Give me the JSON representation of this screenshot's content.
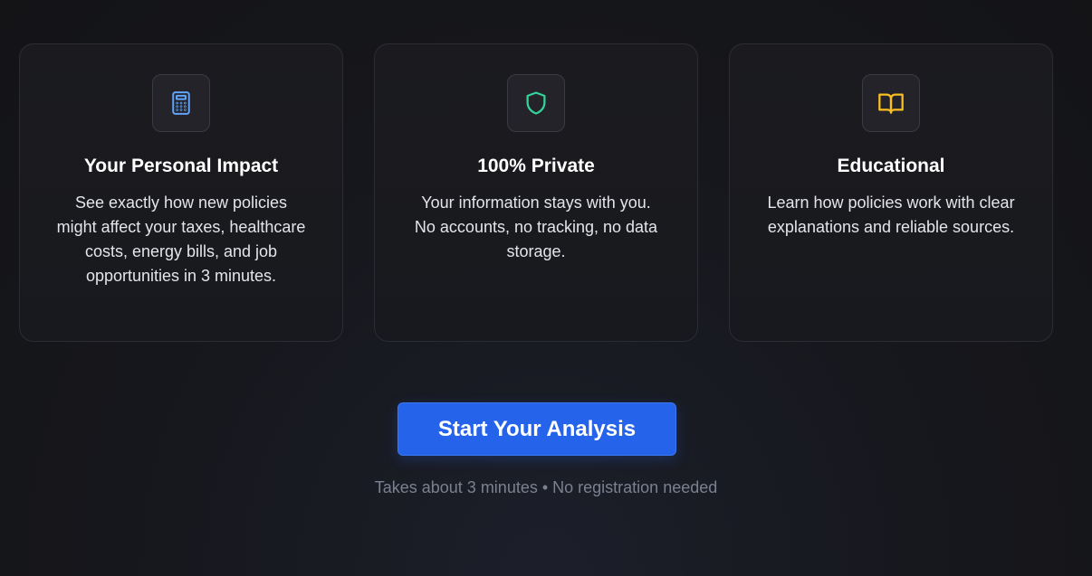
{
  "features": [
    {
      "icon": "calculator-icon",
      "icon_color": "#60a5fa",
      "title": "Your Personal Impact",
      "description": "See exactly how new policies might affect your taxes, healthcare costs, energy bills, and job opportunities in 3 minutes."
    },
    {
      "icon": "shield-icon",
      "icon_color": "#34d399",
      "title": "100% Private",
      "description": "Your information stays with you. No accounts, no tracking, no data storage."
    },
    {
      "icon": "book-open-icon",
      "icon_color": "#fbbf24",
      "title": "Educational",
      "description": "Learn how policies work with clear explanations and reliable sources."
    }
  ],
  "cta": {
    "label": "Start Your Analysis",
    "color": "#2563eb"
  },
  "note": "Takes about 3 minutes • No registration needed"
}
